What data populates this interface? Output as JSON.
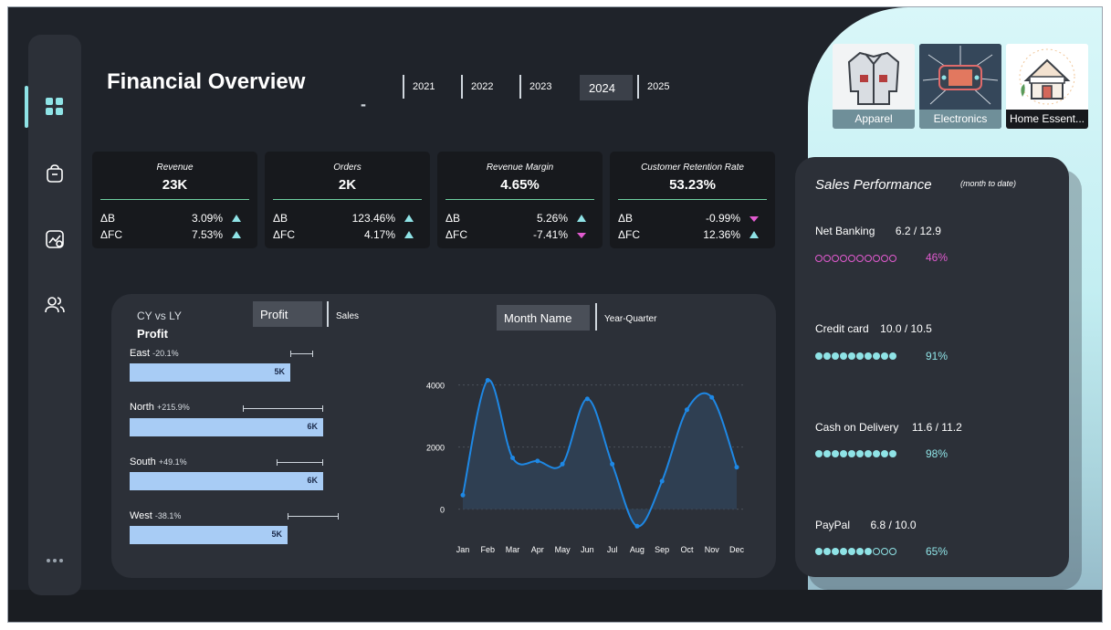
{
  "title": "Financial Overview",
  "title_dash": "-",
  "years": [
    "2021",
    "2022",
    "2023",
    "2024",
    "2025"
  ],
  "selected_year": "2024",
  "categories": [
    {
      "label": "Apparel",
      "icon": "jacket-icon"
    },
    {
      "label": "Electronics",
      "icon": "game-console-icon"
    },
    {
      "label": "Home Essent...",
      "icon": "house-icon"
    }
  ],
  "kpis": [
    {
      "title": "Revenue",
      "value": "23K",
      "db_label": "ΔB",
      "db": "3.09%",
      "db_dir": "up",
      "dfc_label": "ΔFC",
      "dfc": "7.53%",
      "dfc_dir": "up"
    },
    {
      "title": "Orders",
      "value": "2K",
      "db_label": "ΔB",
      "db": "123.46%",
      "db_dir": "up",
      "dfc_label": "ΔFC",
      "dfc": "4.17%",
      "dfc_dir": "up"
    },
    {
      "title": "Revenue Margin",
      "value": "4.65%",
      "db_label": "ΔB",
      "db": "5.26%",
      "db_dir": "up",
      "dfc_label": "ΔFC",
      "dfc": "-7.41%",
      "dfc_dir": "down"
    },
    {
      "title": "Customer Retention Rate",
      "value": "53.23%",
      "db_label": "ΔB",
      "db": "-0.99%",
      "db_dir": "down",
      "dfc_label": "ΔFC",
      "dfc": "12.36%",
      "dfc_dir": "up"
    }
  ],
  "main": {
    "subtitle": "CY vs LY",
    "metric": "Profit",
    "metric_toggle": {
      "selected": "Profit",
      "other": "Sales"
    },
    "period_toggle": {
      "selected": "Month Name",
      "other": "Year-Quarter"
    }
  },
  "regions": [
    {
      "name": "East",
      "change": "-20.1%",
      "label": "5K",
      "value": 5000,
      "ly": 6300
    },
    {
      "name": "North",
      "change": "+215.9%",
      "label": "6K",
      "value": 6000,
      "ly": 1900
    },
    {
      "name": "South",
      "change": "+49.1%",
      "label": "6K",
      "value": 6000,
      "ly": 4000
    },
    {
      "name": "West",
      "change": "-38.1%",
      "label": "5K",
      "value": 4900,
      "ly": 7900
    }
  ],
  "chart_data": {
    "type": "line",
    "categories": [
      "Jan",
      "Feb",
      "Mar",
      "Apr",
      "May",
      "Jun",
      "Jul",
      "Aug",
      "Sep",
      "Oct",
      "Nov",
      "Dec"
    ],
    "values": [
      450,
      4150,
      1650,
      1550,
      1450,
      3550,
      1450,
      -550,
      900,
      3200,
      3600,
      1350
    ],
    "yticks": [
      "4000",
      "2000",
      "0"
    ],
    "ylim": [
      -600,
      4400
    ],
    "title": "",
    "xlabel": "",
    "ylabel": "",
    "grid": true,
    "area_fill": true
  },
  "perf": {
    "title": "Sales Performance",
    "subtitle": "(month to date)",
    "methods": [
      {
        "name": "Net Banking",
        "ratio": "6.2 / 12.9",
        "pct": "46%",
        "filled": 0,
        "color": "#e25bd0"
      },
      {
        "name": "Credit card",
        "ratio": "10.0 / 10.5",
        "pct": "91%",
        "filled": 10,
        "color": "#8fe3e6"
      },
      {
        "name": "Cash on Delivery",
        "ratio": "11.6 / 11.2",
        "pct": "98%",
        "filled": 10,
        "color": "#8fe3e6"
      },
      {
        "name": "PayPal",
        "ratio": "6.8 / 10.0",
        "pct": "65%",
        "filled": 7,
        "color": "#8fe3e6"
      }
    ]
  },
  "colors": {
    "accent": "#8fe3e6",
    "negative": "#e25bd0",
    "bar": "#a8ccf5",
    "line": "#1e88e5"
  }
}
